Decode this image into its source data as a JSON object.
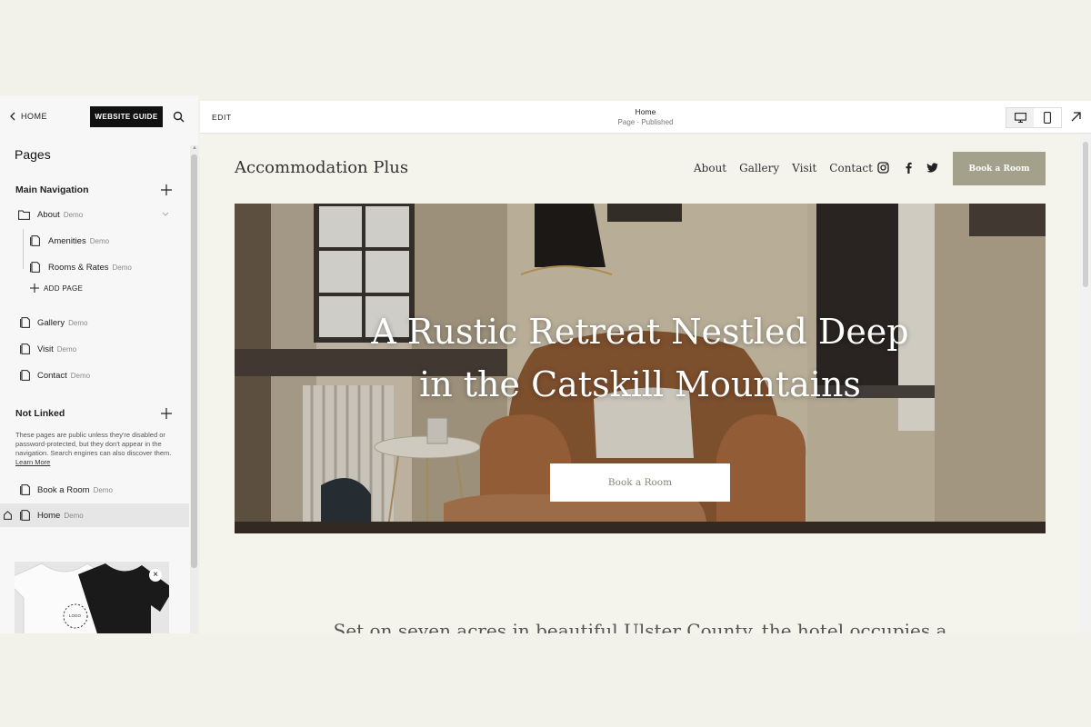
{
  "sidebar": {
    "back_label": "HOME",
    "guide_label": "WEBSITE GUIDE",
    "title": "Pages",
    "main_nav_label": "Main Navigation",
    "add_page_label": "ADD PAGE",
    "not_linked_label": "Not Linked",
    "not_linked_note": "These pages are public unless they're disabled or password-protected, but they don't appear in the navigation. Search engines can also discover them.",
    "learn_more": "Learn More",
    "demo_tag": "Demo",
    "main_items": [
      {
        "label": "About",
        "icon": "folder-icon"
      },
      {
        "label": "Amenities",
        "icon": "page-icon"
      },
      {
        "label": "Rooms & Rates",
        "icon": "page-icon"
      },
      {
        "label": "Gallery",
        "icon": "page-icon"
      },
      {
        "label": "Visit",
        "icon": "page-icon"
      },
      {
        "label": "Contact",
        "icon": "page-icon"
      }
    ],
    "unlinked_items": [
      {
        "label": "Book a Room",
        "icon": "page-icon"
      },
      {
        "label": "Home",
        "icon": "page-icon",
        "homepage": true,
        "selected": true
      }
    ],
    "promo_logo_text": "LOGO"
  },
  "topbar": {
    "edit_label": "EDIT",
    "page_name": "Home",
    "page_status": "Page · Published",
    "device_active": "desktop"
  },
  "site": {
    "title": "Accommodation Plus",
    "nav": [
      "About",
      "Gallery",
      "Visit",
      "Contact"
    ],
    "social_icons": [
      "instagram-icon",
      "facebook-icon",
      "twitter-icon"
    ],
    "cta_label": "Book a Room",
    "hero_line1": "A Rustic Retreat Nestled Deep",
    "hero_line2": "in the Catskill Mountains",
    "hero_button": "Book a Room",
    "intro_text": "Set on seven acres in beautiful Ulster County, the hotel occupies a",
    "accent_color": "#a3a18b"
  }
}
